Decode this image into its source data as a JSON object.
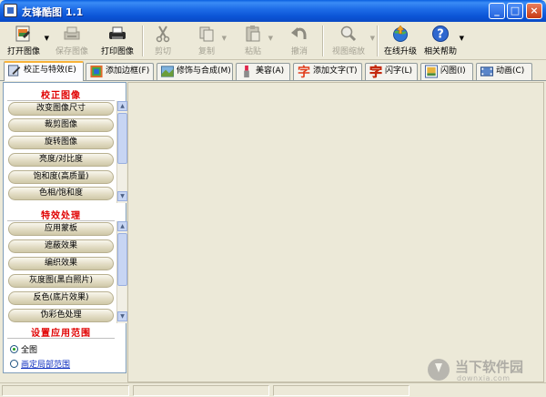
{
  "window": {
    "title": "友锋酷图  1.1",
    "controls": {
      "minimize": "_",
      "maximize": "□",
      "close": "×"
    }
  },
  "toolbar": {
    "buttons": [
      {
        "label": "打开图像",
        "icon": "open-image-icon",
        "enabled": true,
        "dropdown": true
      },
      {
        "label": "保存图像",
        "icon": "save-image-icon",
        "enabled": false,
        "dropdown": false
      },
      {
        "label": "打印图像",
        "icon": "printer-icon",
        "enabled": true,
        "dropdown": false
      },
      {
        "label": "剪切",
        "icon": "scissors-icon",
        "enabled": false,
        "dropdown": false
      },
      {
        "label": "复制",
        "icon": "copy-icon",
        "enabled": false,
        "dropdown": true
      },
      {
        "label": "粘贴",
        "icon": "paste-icon",
        "enabled": false,
        "dropdown": true
      },
      {
        "label": "撤消",
        "icon": "undo-icon",
        "enabled": false,
        "dropdown": false
      },
      {
        "label": "视图缩放",
        "icon": "zoom-icon",
        "enabled": false,
        "dropdown": true
      },
      {
        "label": "在线升级",
        "icon": "online-upgrade-icon",
        "enabled": true,
        "dropdown": false
      },
      {
        "label": "相关帮助",
        "icon": "help-icon",
        "enabled": true,
        "dropdown": true
      }
    ]
  },
  "tabs": [
    {
      "label": "校正与特效(E)",
      "icon": "correction-icon",
      "active": true
    },
    {
      "label": "添加边框(F)",
      "icon": "frame-icon",
      "active": false
    },
    {
      "label": "修饰与合成(M)",
      "icon": "compose-icon",
      "active": false
    },
    {
      "label": "美容(A)",
      "icon": "beauty-icon",
      "active": false
    },
    {
      "label": "添加文字(T)",
      "icon": "text-icon",
      "active": false
    },
    {
      "label": "闪字(L)",
      "icon": "flash-text-icon",
      "active": false
    },
    {
      "label": "闪图(I)",
      "icon": "flash-image-icon",
      "active": false
    },
    {
      "label": "动画(C)",
      "icon": "animation-icon",
      "active": false
    }
  ],
  "panel": {
    "section1": {
      "title": "校正图像",
      "items": [
        "改变图像尺寸",
        "裁剪图像",
        "旋转图像",
        "亮度/对比度",
        "饱和度(高质量)",
        "色相/饱和度"
      ]
    },
    "section2": {
      "title": "特效处理",
      "items": [
        "应用蒙板",
        "遮蔽效果",
        "编织效果",
        "灰度图(黑白照片)",
        "反色(底片效果)",
        "伪彩色处理"
      ]
    },
    "section3": {
      "title": "设置应用范围",
      "options": [
        {
          "label": "全图",
          "selected": true
        },
        {
          "label": "画定局部范围",
          "selected": false
        }
      ]
    }
  },
  "watermark": {
    "text": "当下软件园",
    "sub": "downxia.com"
  },
  "colors": {
    "title_bar": "#0a54d6",
    "section_title": "#e00000",
    "link": "#1030c0",
    "active_tab_accent": "#f8b33a"
  }
}
